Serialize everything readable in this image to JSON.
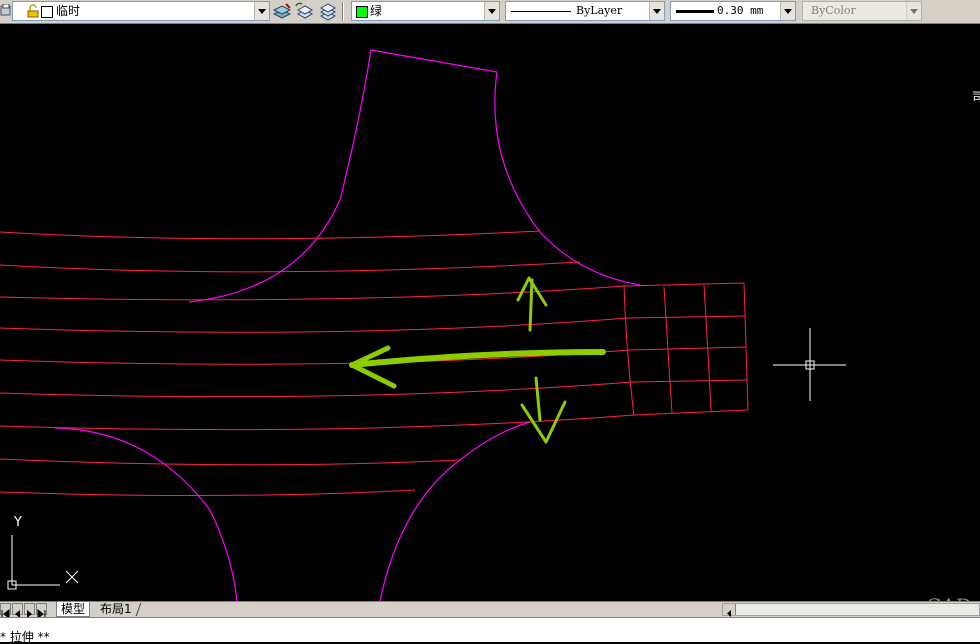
{
  "toolbar": {
    "layer_name": "临时",
    "color_name": "绿",
    "color_swatch": "#00ff00",
    "linetype": "ByLayer",
    "lineweight": "0.30 mm",
    "plotstyle": "ByColor"
  },
  "canvas": {
    "background": "#000000",
    "outline_color": "#ff00ff",
    "hatch_color": "#ff2050",
    "annotation_color": "#8ccc00",
    "right_edge_char": "司"
  },
  "ucs": {
    "y_label": "Y"
  },
  "tabs": {
    "model": "模型",
    "layout1": "布局1"
  },
  "command": {
    "text": "* 拉伸 **"
  },
  "watermark": {
    "text": "CAD"
  }
}
